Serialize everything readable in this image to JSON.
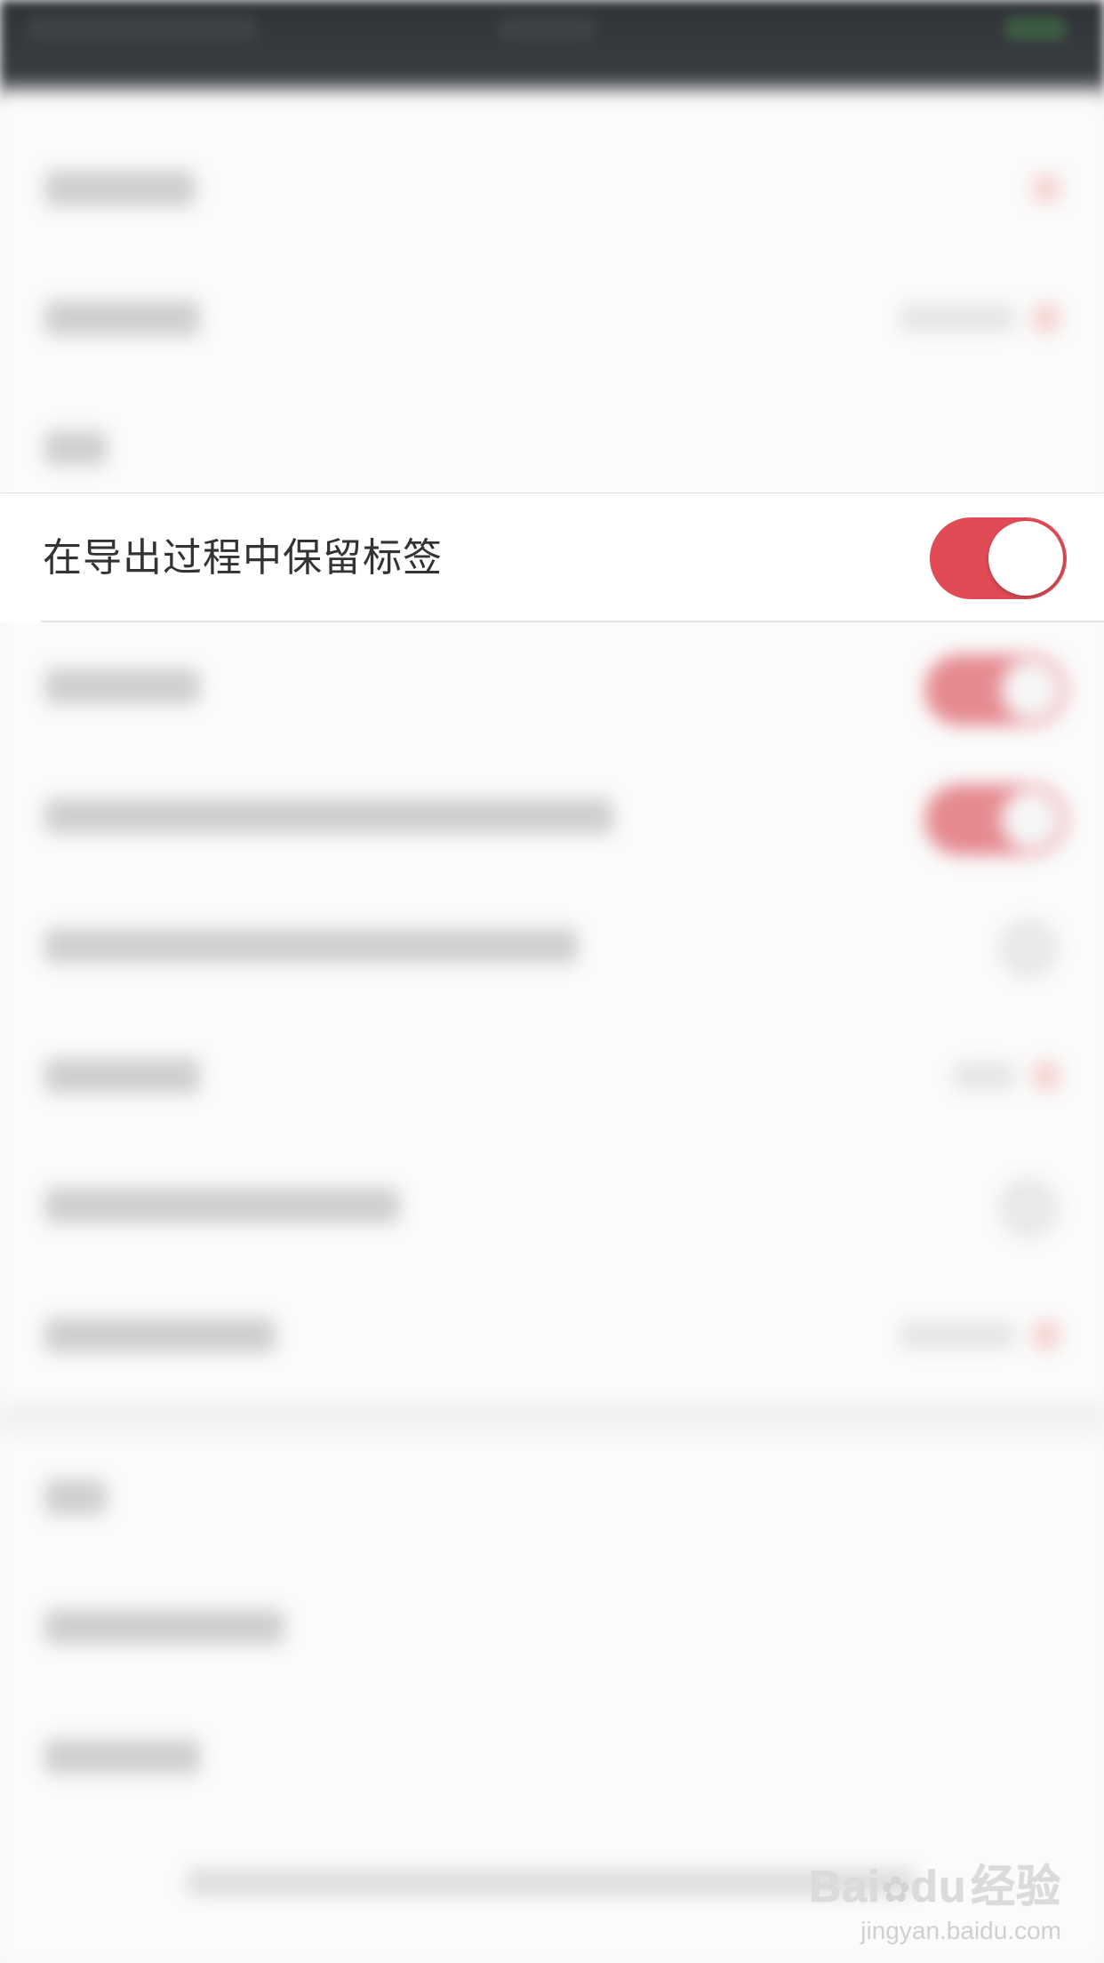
{
  "settings": {
    "focused_row": {
      "label": "在导出过程中保留标签",
      "toggle_on": true
    }
  },
  "colors": {
    "toggle_on": "#e04b55",
    "status_bar": "#2f3236",
    "background": "#f7f7f7"
  },
  "watermark": {
    "brand": "Bai",
    "brand2": "du",
    "brand_cn": "经验",
    "url": "jingyan.baidu.com"
  }
}
